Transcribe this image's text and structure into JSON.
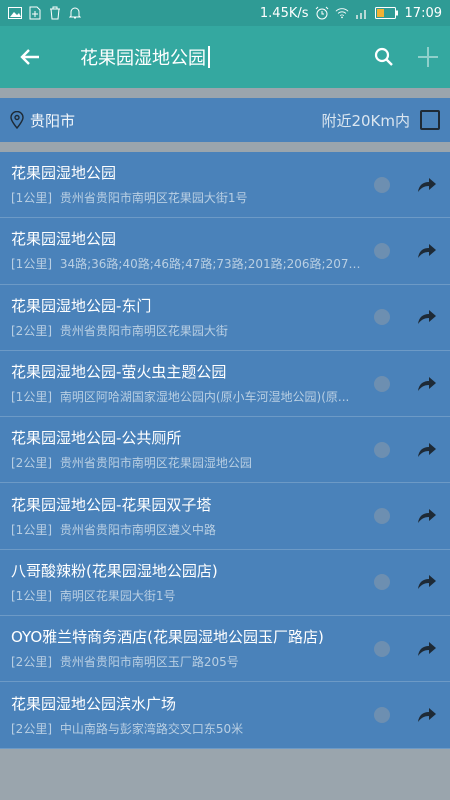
{
  "status_bar": {
    "net_speed": "1.45K/s",
    "time": "17:09",
    "left_icons": [
      "image-icon",
      "sim-icon",
      "trash-icon",
      "bell-icon"
    ],
    "right_icons": [
      "alarm-icon",
      "wifi-icon",
      "signal-icon",
      "battery-icon"
    ]
  },
  "toolbar": {
    "query": "花果园湿地公园"
  },
  "filter": {
    "city": "贵阳市",
    "nearby_label": "附近20Km内",
    "nearby_checked": false
  },
  "results": [
    {
      "title": "花果园湿地公园",
      "distance": "[1公里]",
      "address": "贵州省贵阳市南明区花果园大街1号"
    },
    {
      "title": "花果园湿地公园",
      "distance": "[1公里]",
      "address": "34路;36路;40路;46路;47路;73路;201路;206路;207路;2..."
    },
    {
      "title": "花果园湿地公园-东门",
      "distance": "[2公里]",
      "address": "贵州省贵阳市南明区花果园大街"
    },
    {
      "title": "花果园湿地公园-萤火虫主题公园",
      "distance": "[1公里]",
      "address": "南明区阿哈湖国家湿地公园内(原小车河湿地公园)(原..."
    },
    {
      "title": "花果园湿地公园-公共厕所",
      "distance": "[2公里]",
      "address": "贵州省贵阳市南明区花果园湿地公园"
    },
    {
      "title": "花果园湿地公园-花果园双子塔",
      "distance": "[1公里]",
      "address": "贵州省贵阳市南明区遵义中路"
    },
    {
      "title": "八哥酸辣粉(花果园湿地公园店)",
      "distance": "[1公里]",
      "address": "南明区花果园大街1号"
    },
    {
      "title": "OYO雅兰特商务酒店(花果园湿地公园玉厂路店)",
      "distance": "[2公里]",
      "address": "贵州省贵阳市南明区玉厂路205号"
    },
    {
      "title": "花果园湿地公园滨水广场",
      "distance": "[2公里]",
      "address": "中山南路与彭家湾路交叉口东50米"
    }
  ]
}
